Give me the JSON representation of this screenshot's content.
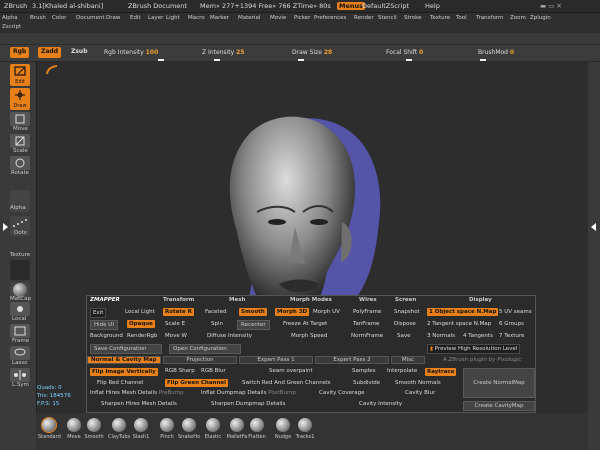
{
  "titlebar": {
    "app": "ZBrush",
    "version": "3.1[Khaled al-shibani]",
    "document": "ZBrush Document",
    "mem": "Mem» 277+1394 Free» 766 ZTime» 80s",
    "menus": "Menus",
    "script": "DefaultZScript",
    "help": "Help"
  },
  "menubar": {
    "row1": [
      "Alpha",
      "Brush",
      "Color",
      "Document",
      "Draw",
      "Edit",
      "Layer",
      "Light",
      "Macro",
      "Marker",
      "Material",
      "Movie",
      "Picker",
      "Preferences",
      "Render",
      "Stencil",
      "Stroke",
      "Texture",
      "Tool",
      "Transform",
      "Zoom",
      "Zplugin"
    ],
    "row2": [
      "Zscript"
    ]
  },
  "toolbar": {
    "rgb": "Rgb",
    "zadd": "Zadd",
    "zsub": "Zsub",
    "rgb_intensity_label": "Rgb Intensity",
    "rgb_intensity_value": "100",
    "z_intensity_label": "Z Intensity",
    "z_intensity_value": "25",
    "draw_size_label": "Draw Size",
    "draw_size_value": "28",
    "focal_shift_label": "Focal Shift",
    "focal_shift_value": "0",
    "brushmod_label": "BrushMod",
    "brushmod_value": "0"
  },
  "leftcol": {
    "edit": "Edit",
    "draw": "Draw",
    "move": "Move",
    "scale": "Scale",
    "rotate": "Rotate",
    "alpha": "Alpha",
    "dots": "Dots",
    "texture": "Texture",
    "matcap": "MatCap",
    "local": "Local",
    "frame": "Frame",
    "lasso": "Lasso",
    "lsym": "L.Sym"
  },
  "status": {
    "quads": "Quads: 0",
    "tris": "Tris: 184576",
    "fps": "F.P.S: 15"
  },
  "zmapper": {
    "logo": "ZMAPPER",
    "headers": {
      "transform": "Transform",
      "mesh": "Mesh",
      "morph_modes": "Morph Modes",
      "wires": "Wires",
      "screen": "Screen",
      "display": "Display"
    },
    "exit": "Exit",
    "local_light": "Local Light",
    "rotate": "Rotate",
    "rotate_key": "R",
    "faceted": "Faceted",
    "smooth": "Smooth",
    "morph3d": "Morph 3D",
    "morph_uv": "Morph UV",
    "polyframe": "PolyFrame",
    "snapshot": "Snapshot",
    "display_1": "1 Object space N.Map",
    "display_5": "5 UV seams",
    "hide_ui": "Hide UI",
    "opaque": "Opaque",
    "scale": "Scale",
    "scale_key": "E",
    "spin": "Spin",
    "recenter": "Recenter",
    "freeze_target": "Freeze At Target",
    "tanframe": "TanFrame",
    "dispose": "Dispose",
    "display_2": "2 Tangent space N.Map",
    "display_6": "6 Groups",
    "background": "Background",
    "render_rgb": "RenderRgb",
    "move": "Move",
    "move_key": "W",
    "diffuse_intensity": "Diffuse Intensity",
    "morph_speed": "Morph Speed",
    "normframe": "NormFrame",
    "save": "Save",
    "display_3": "3 Normals",
    "display_4": "4 Tangents",
    "display_7": "7 Texture",
    "save_config": "Save Configuration",
    "open_config": "Open Configuration",
    "preview_hires": "Preview High Resolution Level",
    "tabs": [
      "Normal & Cavity Map",
      "Projection",
      "Expert Pass 1",
      "Expert Pass 2",
      "Misc"
    ],
    "credit": "A ZBrush plugin by Pixologic",
    "flip_v": "Flip Image Vertically",
    "rgb_sharp": "RGB Sharp",
    "rgb_blur": "RGB Blur",
    "seam_overpaint": "Seam overpaint",
    "samples": "Samples",
    "interpolate": "Interpolate",
    "raytrace": "Raytrace",
    "flip_red": "Flip Red Channel",
    "flip_green": "Flip Green Channel",
    "switch_rg": "Switch Red And Green Channels",
    "subdivide": "Subdivide",
    "smooth_normals": "Smooth Normals",
    "create_normalmap": "Create NormalMap",
    "inflat_hires": "Inflat Hires Mesh Details",
    "prebump": "PreBump",
    "inflat_dump": "Inflat Dumpmap Details",
    "postbump": "PostBump",
    "cavity_coverage": "Cavity Coverage",
    "cavity_blur": "Cavity Blur",
    "sharpen_hires": "Sharpen Hires Mesh Details",
    "sharpen_dump": "Sharpen Dumpmap Details",
    "cavity_intensity": "Cavity Intensity",
    "create_cavitymap": "Create CavityMap"
  },
  "brushes": [
    "Standard",
    "Move",
    "Smooth",
    "ClayTubs",
    "Slash1",
    "Pinch",
    "SnakeHo",
    "Elastic",
    "MalletFa",
    "Flatten",
    "Nudge",
    "Tracks1"
  ],
  "colors": {
    "accent": "#e8801a",
    "canvas": "#2d2d2d",
    "stat": "#7cd0ff"
  }
}
